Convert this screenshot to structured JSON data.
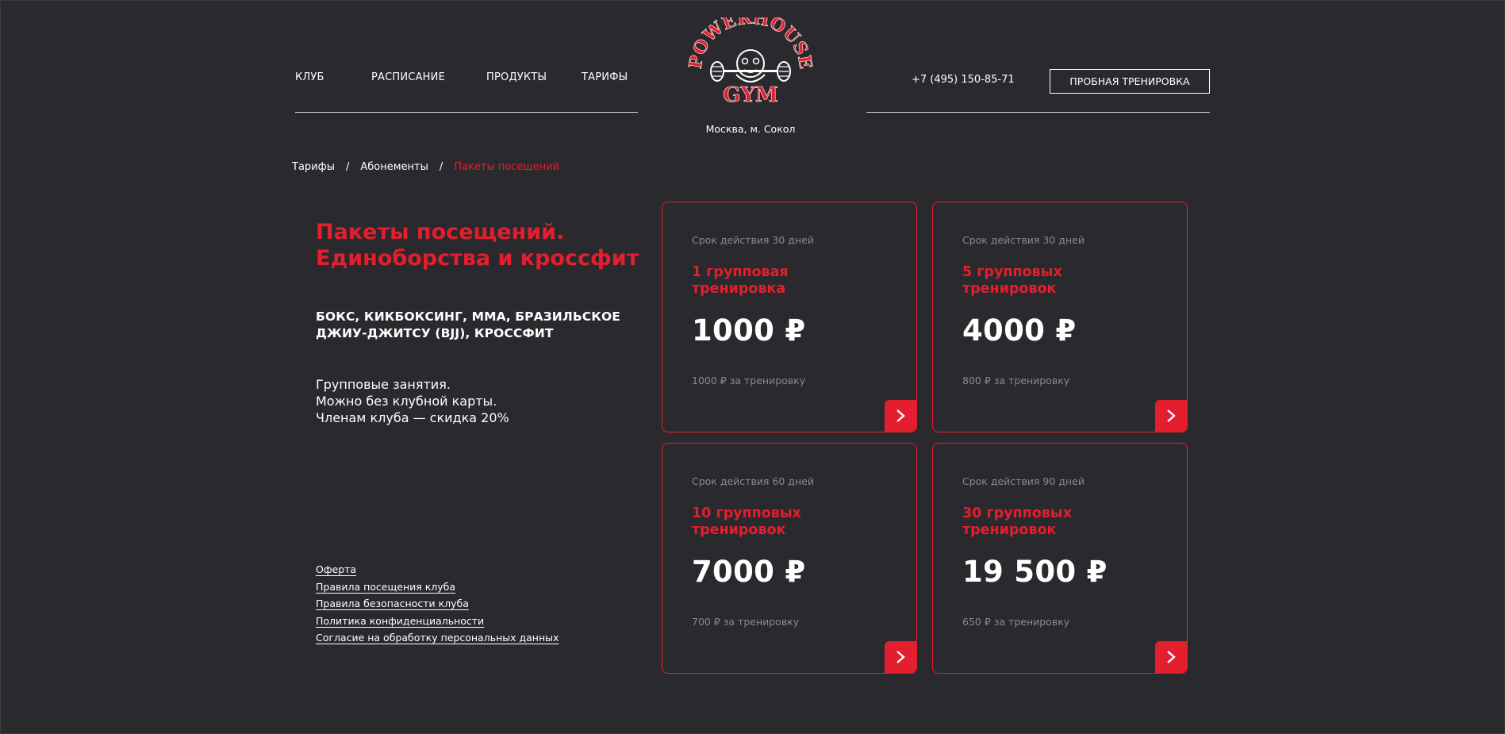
{
  "header": {
    "nav": [
      {
        "label": "КЛУБ"
      },
      {
        "label": "РАСПИСАНИЕ"
      },
      {
        "label": "ПРОДУКТЫ"
      },
      {
        "label": "ТАРИФЫ"
      }
    ],
    "logo_top": "POWERHOUSE",
    "logo_bottom": "GYM",
    "city": "Москва, м. Сокол",
    "phone": "+7 (495) 150-85-71",
    "trial_button": "ПРОБНАЯ ТРЕНИРОВКА",
    "logo_icon": "gym-mascot-logo"
  },
  "breadcrumb": [
    {
      "label": "Тарифы"
    },
    {
      "label": "Абонементы"
    },
    {
      "label": "Пакеты посещений"
    }
  ],
  "breadcrumb_sep": "/",
  "intro": {
    "title_line1": "Пакеты посещений.",
    "title_line2": "Единоборства и кроссфит",
    "disciplines_line1": "БОКС, КИКБОКСИНГ, ММА, БРАЗИЛЬСКОЕ",
    "disciplines_line2": "ДЖИУ-ДЖИТСУ (BJJ), КРОССФИТ",
    "desc": [
      "Групповые занятия.",
      "Можно без клубной карты.",
      "Членам клуба — скидка 20%"
    ]
  },
  "legal_links": [
    "Оферта",
    "Правила посещения клуба",
    "Правила безопасности клуба",
    "Политика конфиденциальности",
    "Согласие на обработку персональных данных"
  ],
  "cards": [
    {
      "validity": "Срок действия 30 дней",
      "name_line1": "1 групповая",
      "name_line2": "тренировка",
      "price": "1000 ₽",
      "per": "1000 ₽ за тренировку"
    },
    {
      "validity": "Срок действия 30 дней",
      "name_line1": "5 групповых",
      "name_line2": "тренировок",
      "price": "4000 ₽",
      "per": "800 ₽ за тренировку"
    },
    {
      "validity": "Срок действия 60 дней",
      "name_line1": "10 групповых",
      "name_line2": "тренировок",
      "price": "7000 ₽",
      "per": "700 ₽ за тренировку"
    },
    {
      "validity": "Срок действия 90 дней",
      "name_line1": "30 групповых",
      "name_line2": "тренировок",
      "price": "19 500 ₽",
      "per": "650 ₽ за тренировку"
    }
  ],
  "colors": {
    "accent": "#e31e2d",
    "background": "#2a2a2e",
    "muted": "#8a8a8e"
  }
}
